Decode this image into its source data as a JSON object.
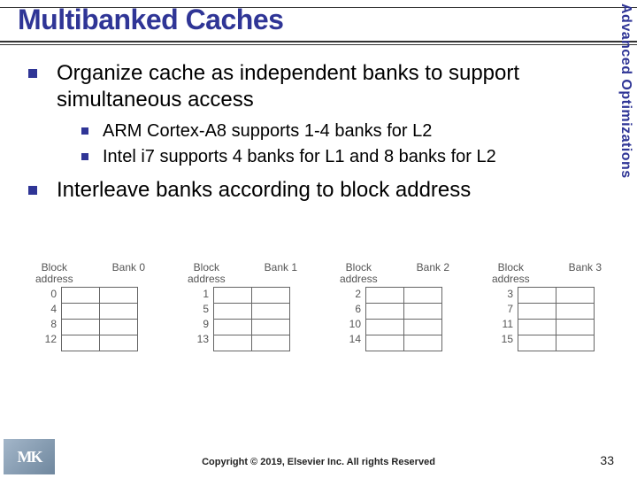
{
  "title": "Multibanked Caches",
  "side_label": "Advanced Optimizations",
  "bullets": {
    "b1": "Organize cache as independent banks to support simultaneous access",
    "b1a": "ARM Cortex-A8 supports 1-4 banks for L2",
    "b1b": "Intel i7 supports 4 banks for L1 and 8 banks for L2",
    "b2": "Interleave banks according to block address"
  },
  "diagram": {
    "header_block": "Block\naddress",
    "banks": [
      {
        "name": "Bank 0",
        "addrs": [
          "0",
          "4",
          "8",
          "12"
        ]
      },
      {
        "name": "Bank 1",
        "addrs": [
          "1",
          "5",
          "9",
          "13"
        ]
      },
      {
        "name": "Bank 2",
        "addrs": [
          "2",
          "6",
          "10",
          "14"
        ]
      },
      {
        "name": "Bank 3",
        "addrs": [
          "3",
          "7",
          "11",
          "15"
        ]
      }
    ]
  },
  "footer": {
    "copyright": "Copyright © 2019, Elsevier Inc. All rights Reserved",
    "page": "33",
    "logo_text": "MK"
  }
}
